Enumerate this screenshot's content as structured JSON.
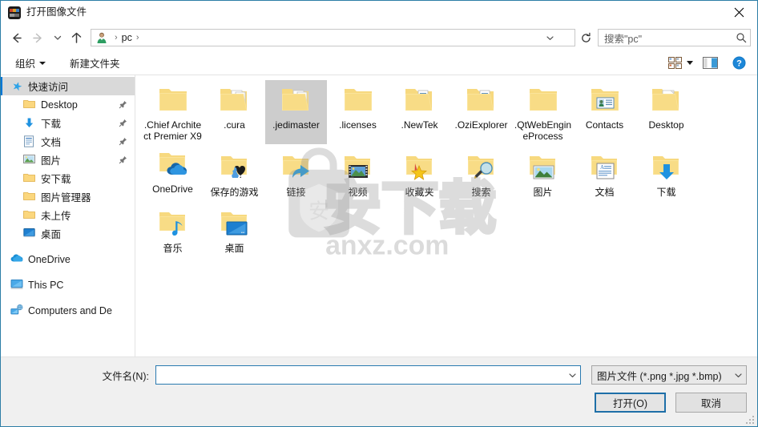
{
  "window": {
    "title": "打开图像文件",
    "app_icon": "app-icon",
    "close_label": "✕"
  },
  "nav": {
    "back_icon": "back-arrow-icon",
    "forward_icon": "forward-arrow-icon",
    "recent_icon": "chevron-down-icon",
    "up_icon": "up-arrow-icon",
    "refresh_icon": "refresh-icon",
    "dropdown_icon": "chevron-down-icon",
    "breadcrumb": [
      {
        "label": "",
        "icon": "user-account-icon"
      },
      {
        "label": "pc",
        "icon": ""
      }
    ],
    "separator": "›"
  },
  "search": {
    "placeholder": "搜索\"pc\"",
    "value": "",
    "icon": "search-icon"
  },
  "toolbar": {
    "organize_label": "组织",
    "new_folder_label": "新建文件夹",
    "view_icon": "view-layout-icon",
    "view_caret": "chevron-down-icon",
    "preview_icon": "preview-pane-icon",
    "help_icon": "help-icon"
  },
  "sidebar": {
    "items": [
      {
        "label": "快速访问",
        "icon": "quick-access-star-icon",
        "selected": true,
        "pinned": false,
        "indent": 2
      },
      {
        "label": "Desktop",
        "icon": "folder-icon",
        "selected": false,
        "pinned": true,
        "indent": 1
      },
      {
        "label": "下载",
        "icon": "download-arrow-icon",
        "selected": false,
        "pinned": true,
        "indent": 1
      },
      {
        "label": "文档",
        "icon": "document-icon",
        "selected": false,
        "pinned": true,
        "indent": 1
      },
      {
        "label": "图片",
        "icon": "picture-icon",
        "selected": false,
        "pinned": true,
        "indent": 1
      },
      {
        "label": "安下载",
        "icon": "folder-icon",
        "selected": false,
        "pinned": false,
        "indent": 1
      },
      {
        "label": "图片管理器",
        "icon": "folder-icon",
        "selected": false,
        "pinned": false,
        "indent": 1
      },
      {
        "label": "未上传",
        "icon": "folder-icon",
        "selected": false,
        "pinned": false,
        "indent": 1
      },
      {
        "label": "桌面",
        "icon": "monitor-icon",
        "selected": false,
        "pinned": false,
        "indent": 1
      },
      {
        "label": "OneDrive",
        "icon": "onedrive-cloud-icon",
        "selected": false,
        "pinned": false,
        "indent": 2,
        "gap_before": true
      },
      {
        "label": "This PC",
        "icon": "this-pc-icon",
        "selected": false,
        "pinned": false,
        "indent": 2,
        "gap_before": true
      },
      {
        "label": "Computers and De",
        "icon": "network-icon",
        "selected": false,
        "pinned": false,
        "indent": 2,
        "gap_before": true
      }
    ]
  },
  "files": {
    "items": [
      {
        "name": ".Chief Architect Premier X9",
        "icon": "folder-plain-icon",
        "selected": false
      },
      {
        "name": ".cura",
        "icon": "folder-docs-icon",
        "selected": false
      },
      {
        "name": ".jedimaster",
        "icon": "folder-docs-icon",
        "selected": true
      },
      {
        "name": ".licenses",
        "icon": "folder-plain-icon",
        "selected": false
      },
      {
        "name": ".NewTek",
        "icon": "folder-lined-icon",
        "selected": false
      },
      {
        "name": ".OziExplorer",
        "icon": "folder-lined-icon",
        "selected": false
      },
      {
        "name": ".QtWebEngineProcess",
        "icon": "folder-plain-icon",
        "selected": false
      },
      {
        "name": "Contacts",
        "icon": "folder-contacts-icon",
        "selected": false
      },
      {
        "name": "Desktop",
        "icon": "folder-desktop-icon",
        "selected": false
      },
      {
        "name": "OneDrive",
        "icon": "folder-onedrive-icon",
        "selected": false
      },
      {
        "name": "保存的游戏",
        "icon": "folder-games-icon",
        "selected": false
      },
      {
        "name": "链接",
        "icon": "folder-links-icon",
        "selected": false
      },
      {
        "name": "视频",
        "icon": "folder-videos-icon",
        "selected": false
      },
      {
        "name": "收藏夹",
        "icon": "folder-favorites-icon",
        "selected": false
      },
      {
        "name": "搜索",
        "icon": "folder-search-icon",
        "selected": false
      },
      {
        "name": "图片",
        "icon": "folder-pictures-icon",
        "selected": false
      },
      {
        "name": "文档",
        "icon": "folder-documents-icon",
        "selected": false
      },
      {
        "name": "下载",
        "icon": "folder-downloads-icon",
        "selected": false
      },
      {
        "name": "音乐",
        "icon": "folder-music-icon",
        "selected": false
      },
      {
        "name": "桌面",
        "icon": "folder-desktop2-icon",
        "selected": false
      }
    ]
  },
  "watermark": {
    "shield_char": "安",
    "big_text": "安下载",
    "site_text": "anxz.com"
  },
  "footer": {
    "filename_label": "文件名(N):",
    "filename_value": "",
    "filename_placeholder": "",
    "filetype_value": "图片文件 (*.png *.jpg *.bmp)",
    "open_label": "打开(O)",
    "cancel_label": "取消",
    "dropdown_icon": "chevron-down-icon",
    "resize_grip": "resize-grip-icon"
  },
  "colors": {
    "accent": "#0078d7",
    "selection": "#cdcdcd",
    "folder": "#f6cf63",
    "focus_border": "#1e6fa8"
  }
}
